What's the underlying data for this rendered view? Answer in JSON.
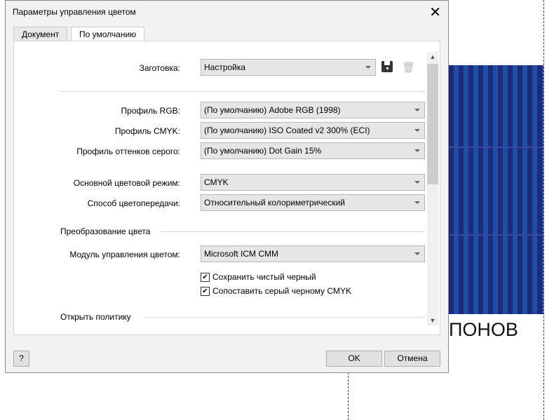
{
  "background": {
    "text": "ПОНОВ"
  },
  "dialog": {
    "title": "Параметры управления цветом",
    "tabs": [
      {
        "label": "Документ"
      },
      {
        "label": "По умолчанию"
      }
    ],
    "preset": {
      "label": "Заготовка:",
      "value": "Настройка"
    },
    "rgb": {
      "label": "Профиль RGB:",
      "value": "(По умолчанию) Adobe RGB (1998)"
    },
    "cmyk": {
      "label": "Профиль CMYK:",
      "value": "(По умолчанию) ISO Coated v2 300% (ECI)"
    },
    "gray": {
      "label": "Профиль оттенков серого:",
      "value": "(По умолчанию) Dot Gain 15%"
    },
    "mode": {
      "label": "Основной цветовой режим:",
      "value": "CMYK"
    },
    "intent": {
      "label": "Способ цветопередачи:",
      "value": "Относительный колориметрический"
    },
    "conversion_section": "Преобразование цвета",
    "cmm": {
      "label": "Модуль управления цветом:",
      "value": "Microsoft ICM CMM"
    },
    "checkboxes": [
      {
        "label": "Сохранить чистый черный",
        "checked": true
      },
      {
        "label": "Сопоставить серый черному CMYK",
        "checked": true
      }
    ],
    "policy_section": "Открыть политику",
    "help": "?",
    "ok": "OK",
    "cancel": "Отмена"
  }
}
